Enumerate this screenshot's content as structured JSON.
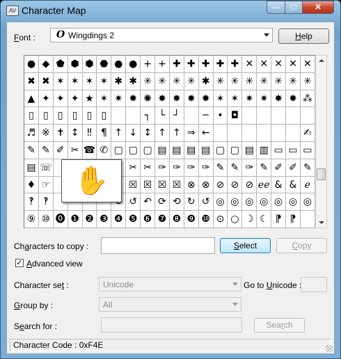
{
  "window": {
    "title": "Character Map",
    "minimize": "—",
    "maximize": "□",
    "close": "✕",
    "app_icon": "AV"
  },
  "font": {
    "label_prefix": "",
    "label_u": "F",
    "label_rest": "ont :",
    "icon": "O",
    "value": "Wingdings 2",
    "help_u": "H",
    "help_rest": "elp"
  },
  "grid": {
    "cells": [
      "●",
      "◆",
      "⬟",
      "⬢",
      "⬢",
      "⬣",
      "●",
      "●",
      "+",
      "+",
      "✚",
      "✚",
      "✚",
      "✚",
      "✚",
      "✕",
      "✕",
      "✕",
      "✕",
      "✕",
      "✖",
      "✖",
      "✶",
      "✶",
      "✶",
      "✶",
      "✱",
      "✱",
      "✳",
      "✳",
      "✳",
      "✳",
      "✱",
      "✳",
      "✳",
      "✳",
      "✳",
      "✳",
      "✳",
      "✳",
      "▲",
      "✦",
      "✦",
      "✦",
      "★",
      "✶",
      "✷",
      "✹",
      "✺",
      "✸",
      "✹",
      "✹",
      "✹",
      "✶",
      "✶",
      "✷",
      "✷",
      "✸",
      "✹",
      "⁂",
      "▯",
      "▯",
      "▯",
      "▯",
      "▯",
      "▯",
      "",
      "",
      "┐",
      "└",
      "┘",
      "",
      "─",
      "•",
      "◘",
      "",
      "",
      "",
      "",
      "",
      "♬",
      "※",
      "✝",
      "↕",
      "‼",
      "¶",
      "↑",
      "↓",
      "↕",
      "↑",
      "↑",
      "⇒",
      "←",
      "",
      "",
      "",
      "",
      "",
      "",
      "✍",
      "✎",
      "✎",
      "✐",
      "✂",
      "☎",
      "✆",
      "▢",
      "▢",
      "▢",
      "▤",
      "▤",
      "▤",
      "▤",
      "▢",
      "▢",
      "▤",
      "▥",
      "▭",
      "▭",
      "▭",
      "▤",
      "☏",
      "",
      "",
      "",
      "",
      "✎",
      "✂",
      "✂",
      "✑",
      "✑",
      "✑",
      "✑",
      "✎",
      "✎",
      "✑",
      "✎",
      "✐",
      "✐",
      "✎",
      "♦",
      "☞",
      "",
      "",
      "",
      "",
      "✓",
      "☒",
      "☒",
      "☒",
      "☒",
      "⊗",
      "⊗",
      "⊘",
      "⊘",
      "⊘",
      "ℯℯ",
      "&",
      "&",
      "ℯ",
      "‽",
      "‽",
      "",
      "",
      "",
      "",
      "↻",
      "↺",
      "↶",
      "⟳",
      "⟲",
      "↻",
      "↺",
      "◎",
      "◎",
      "◎",
      "◎",
      "◎",
      "◎",
      "◎",
      "⑨",
      "⑩",
      "⓿",
      "❶",
      "❷",
      "❸",
      "❹",
      "❺",
      "❻",
      "❼",
      "❽",
      "❾",
      "❿",
      "⊙",
      "○",
      "☽",
      "☾",
      "⁋",
      "⁋",
      ""
    ],
    "popup_glyph": "✋"
  },
  "copy": {
    "label_a": "Ch",
    "label_u": "a",
    "label_b": "racters to copy :",
    "value": "",
    "select_u": "S",
    "select_rest": "elect",
    "copy_u": "C",
    "copy_rest": "opy"
  },
  "advanced": {
    "checked": "✓",
    "label_u": "A",
    "label_b": "dvanced view"
  },
  "charset": {
    "label_a": "Character se",
    "label_u": "t",
    "label_b": " :",
    "value": "Unicode",
    "goto_a": "Go to ",
    "goto_u": "U",
    "goto_b": "nicode :",
    "goto_value": ""
  },
  "group": {
    "label_u": "G",
    "label_b": "roup by :",
    "value": "All"
  },
  "search": {
    "label_a": "S",
    "label_u": "e",
    "label_b": "arch for :",
    "value": "",
    "btn_a": "Sea",
    "btn_u": "r",
    "btn_b": "ch"
  },
  "status": {
    "text": "Character Code : 0xF4E"
  }
}
